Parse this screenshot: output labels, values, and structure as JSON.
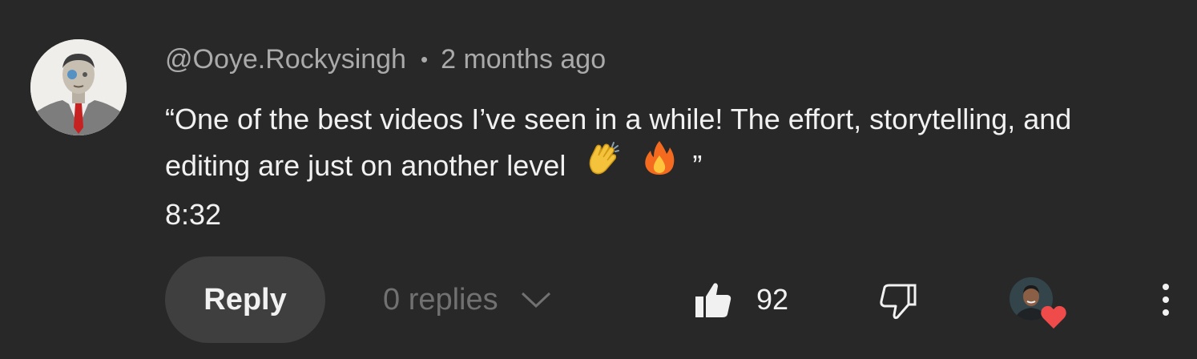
{
  "comment": {
    "author": "@Ooye.Rockysingh",
    "separator": "•",
    "time_ago": "2 months ago",
    "text_line1": "“One of the best videos I’ve seen in a while! The effort, storytelling, and",
    "text_line2_prefix": "editing are just on another level",
    "text_line2_suffix": "”",
    "emojis": [
      "clapping-hands",
      "fire"
    ],
    "timestamp_link": "8:32"
  },
  "actions": {
    "reply_label": "Reply",
    "replies_label": "0 replies",
    "like_count": "92"
  },
  "icons": {
    "like": "thumbs-up-filled-icon",
    "dislike": "thumbs-down-outline-icon",
    "creator_heart": "heart-icon",
    "more": "vertical-ellipsis-icon",
    "replies_toggle": "chevron-down-icon"
  },
  "colors": {
    "background": "#282828",
    "reply_button": "#3f3f3f",
    "primary_text": "#f1f1f1",
    "secondary_text": "#aaaaaa",
    "muted_text": "#717171",
    "heart": "#ef4b4b"
  }
}
